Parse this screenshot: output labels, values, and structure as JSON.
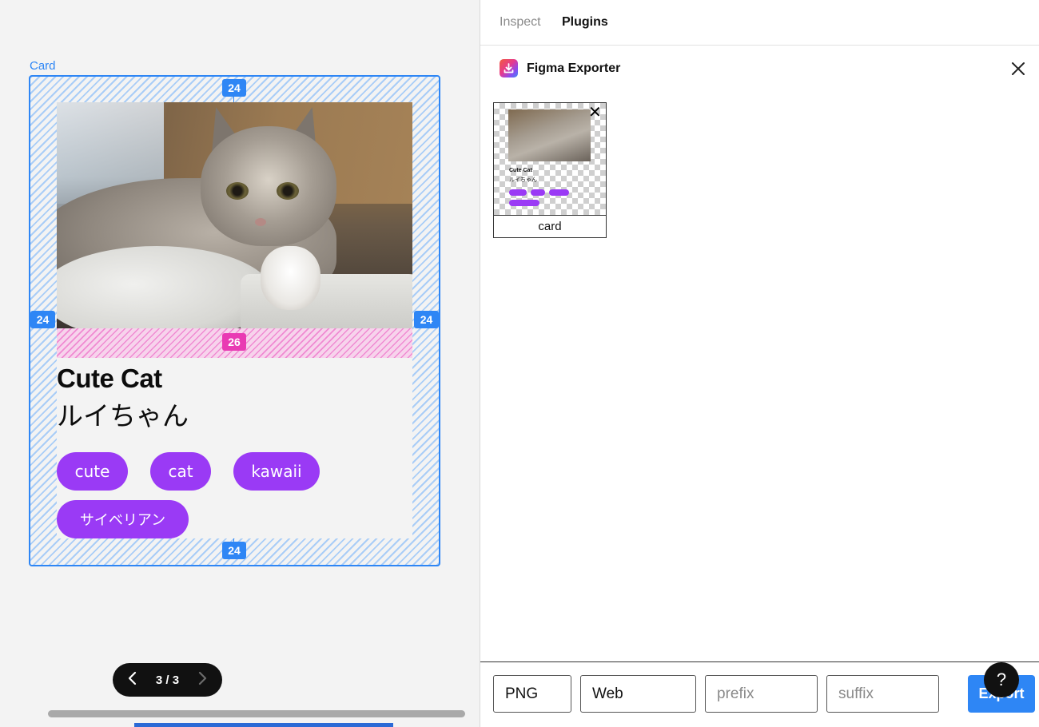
{
  "canvas": {
    "frame_label": "Card",
    "card": {
      "title": "Cute Cat",
      "subtitle": "ルイちゃん",
      "tags": [
        "cute",
        "cat",
        "kawaii",
        "サイベリアン"
      ]
    },
    "measurements": {
      "top": "24",
      "left": "24",
      "right": "24",
      "bottom": "24",
      "gap": "26"
    },
    "pager": {
      "count": "3 / 3",
      "prev_icon": "chevron-left-icon",
      "next_icon": "chevron-right-icon"
    },
    "colors": {
      "selection_blue": "#2e86f5",
      "gap_pink": "#e93ab3",
      "tag_purple": "#9a3af5"
    }
  },
  "panel": {
    "tabs": [
      "Inspect",
      "Plugins"
    ],
    "active_tab": "Plugins",
    "plugin": {
      "name": "Figma Exporter",
      "logo_icon": "download-icon",
      "close_icon": "close-icon"
    },
    "thumbnail": {
      "label": "card",
      "title": "Cute Cat",
      "subtitle": "ルイちゃん",
      "remove_icon": "close-icon"
    },
    "footer": {
      "format": "PNG",
      "preset": "Web",
      "prefix_placeholder": "prefix",
      "suffix_placeholder": "suffix",
      "export_label": "Export",
      "help_label": "?"
    },
    "colors": {
      "export_button": "#2e86f5"
    }
  }
}
